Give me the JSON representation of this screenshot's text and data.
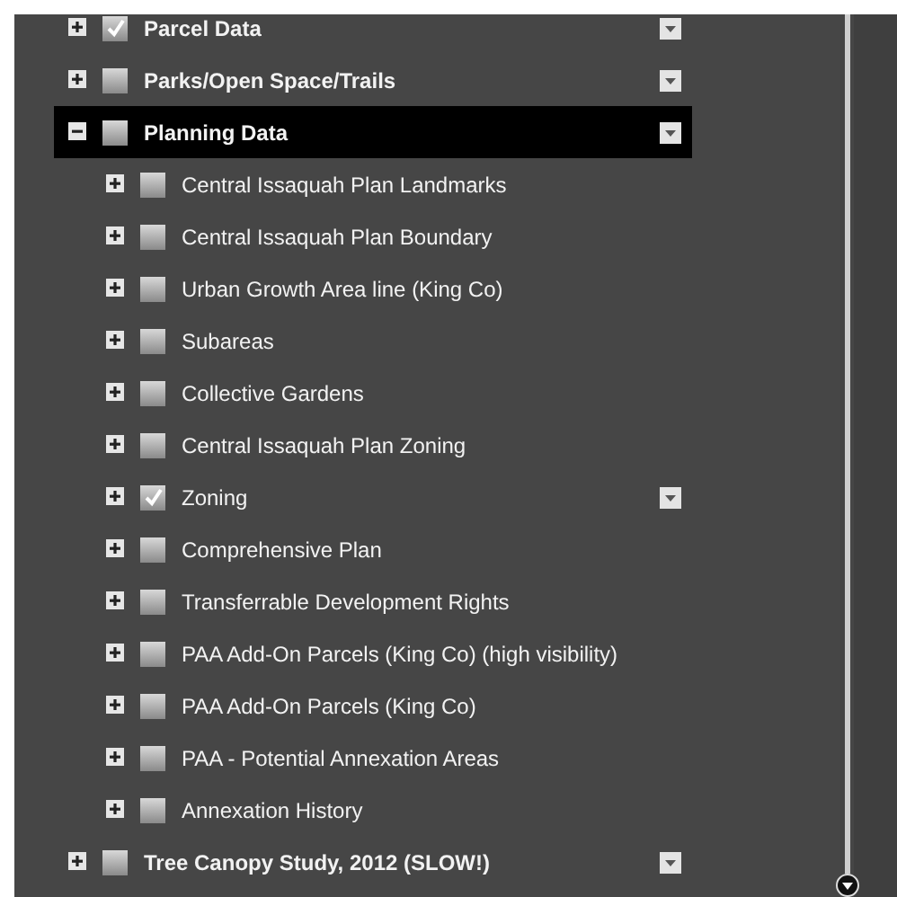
{
  "layers": [
    {
      "label": "Parcel Data",
      "expanded": false,
      "checked": true,
      "selected": false,
      "menu": true
    },
    {
      "label": "Parks/Open Space/Trails",
      "expanded": false,
      "checked": false,
      "selected": false,
      "menu": true
    },
    {
      "label": "Planning Data",
      "expanded": true,
      "checked": false,
      "selected": true,
      "menu": true,
      "children": [
        {
          "label": "Central Issaquah Plan Landmarks",
          "expanded": false,
          "checked": false,
          "selected": false,
          "menu": false
        },
        {
          "label": "Central Issaquah Plan Boundary",
          "expanded": false,
          "checked": false,
          "selected": false,
          "menu": false
        },
        {
          "label": "Urban Growth Area line (King Co)",
          "expanded": false,
          "checked": false,
          "selected": false,
          "menu": false
        },
        {
          "label": "Subareas",
          "expanded": false,
          "checked": false,
          "selected": false,
          "menu": false
        },
        {
          "label": "Collective Gardens",
          "expanded": false,
          "checked": false,
          "selected": false,
          "menu": false
        },
        {
          "label": "Central Issaquah Plan Zoning",
          "expanded": false,
          "checked": false,
          "selected": false,
          "menu": false
        },
        {
          "label": "Zoning",
          "expanded": false,
          "checked": true,
          "selected": false,
          "menu": true
        },
        {
          "label": "Comprehensive Plan",
          "expanded": false,
          "checked": false,
          "selected": false,
          "menu": false
        },
        {
          "label": "Transferrable Development Rights",
          "expanded": false,
          "checked": false,
          "selected": false,
          "menu": false
        },
        {
          "label": "PAA Add-On Parcels (King Co) (high visibility)",
          "expanded": false,
          "checked": false,
          "selected": false,
          "menu": false
        },
        {
          "label": "PAA Add-On Parcels (King Co)",
          "expanded": false,
          "checked": false,
          "selected": false,
          "menu": false
        },
        {
          "label": "PAA - Potential Annexation Areas",
          "expanded": false,
          "checked": false,
          "selected": false,
          "menu": false
        },
        {
          "label": "Annexation History",
          "expanded": false,
          "checked": false,
          "selected": false,
          "menu": false
        }
      ]
    },
    {
      "label": "Tree Canopy Study, 2012 (SLOW!)",
      "expanded": false,
      "checked": false,
      "selected": false,
      "menu": true
    }
  ]
}
